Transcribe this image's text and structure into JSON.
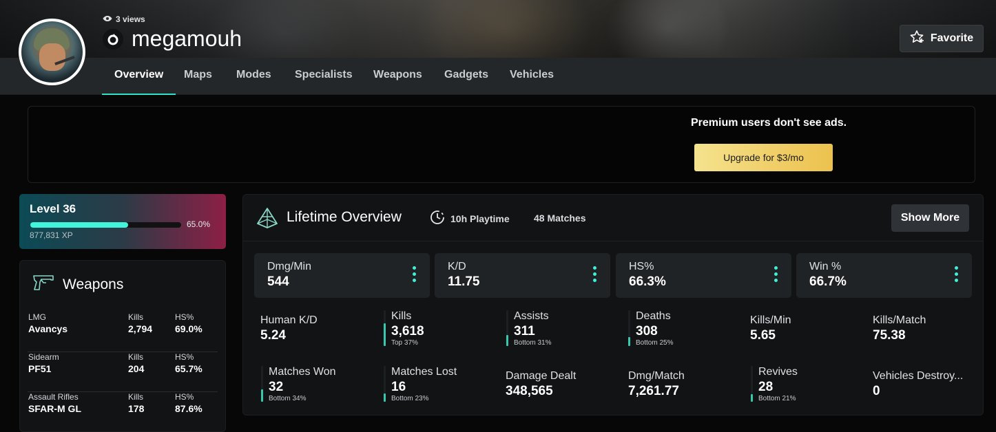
{
  "profile": {
    "views": "3 views",
    "username": "megamouh",
    "favorite_label": "Favorite"
  },
  "nav": {
    "tabs": [
      {
        "label": "Overview",
        "active": true
      },
      {
        "label": "Maps"
      },
      {
        "label": "Modes"
      },
      {
        "label": "Specialists"
      },
      {
        "label": "Weapons"
      },
      {
        "label": "Gadgets"
      },
      {
        "label": "Vehicles"
      }
    ]
  },
  "ad": {
    "text": "Premium users don't see ads.",
    "upgrade_label": "Upgrade for $3/mo"
  },
  "level": {
    "title": "Level 36",
    "progress_text": "65.0%",
    "progress": 0.65,
    "xp": "877,831 XP"
  },
  "weapons": {
    "title": "Weapons",
    "rows": [
      {
        "category": "LMG",
        "name": "Avancys",
        "kills_label": "Kills",
        "kills": "2,794",
        "hs_label": "HS%",
        "hs": "69.0%"
      },
      {
        "category": "Sidearm",
        "name": "PF51",
        "kills_label": "Kills",
        "kills": "204",
        "hs_label": "HS%",
        "hs": "65.7%"
      },
      {
        "category": "Assault Rifles",
        "name": "SFAR-M GL",
        "kills_label": "Kills",
        "kills": "178",
        "hs_label": "HS%",
        "hs": "87.6%"
      }
    ]
  },
  "overview": {
    "title": "Lifetime Overview",
    "playtime": "10h Playtime",
    "matches": "48 Matches",
    "show_more": "Show More",
    "big_stats": [
      {
        "label": "Dmg/Min",
        "value": "544"
      },
      {
        "label": "K/D",
        "value": "11.75"
      },
      {
        "label": "HS%",
        "value": "66.3%"
      },
      {
        "label": "Win %",
        "value": "66.7%"
      }
    ],
    "stats": [
      {
        "label": "Human K/D",
        "value": "5.24"
      },
      {
        "label": "Kills",
        "value": "3,618",
        "rank": "Top 37%",
        "percentile": 0.63
      },
      {
        "label": "Assists",
        "value": "311",
        "rank": "Bottom 31%",
        "percentile": 0.31
      },
      {
        "label": "Deaths",
        "value": "308",
        "rank": "Bottom 25%",
        "percentile": 0.25
      },
      {
        "label": "Kills/Min",
        "value": "5.65"
      },
      {
        "label": "Kills/Match",
        "value": "75.38"
      },
      {
        "label": "Matches Won",
        "value": "32",
        "rank": "Bottom 34%",
        "percentile": 0.34
      },
      {
        "label": "Matches Lost",
        "value": "16",
        "rank": "Bottom 23%",
        "percentile": 0.23
      },
      {
        "label": "Damage Dealt",
        "value": "348,565"
      },
      {
        "label": "Dmg/Match",
        "value": "7,261.77"
      },
      {
        "label": "Revives",
        "value": "28",
        "rank": "Bottom 21%",
        "percentile": 0.21
      },
      {
        "label": "Vehicles Destroy...",
        "value": "0"
      }
    ]
  },
  "colors": {
    "accent": "#33e3c9",
    "upgrade_gold": "#f0cf6a",
    "panel": "#111315"
  }
}
